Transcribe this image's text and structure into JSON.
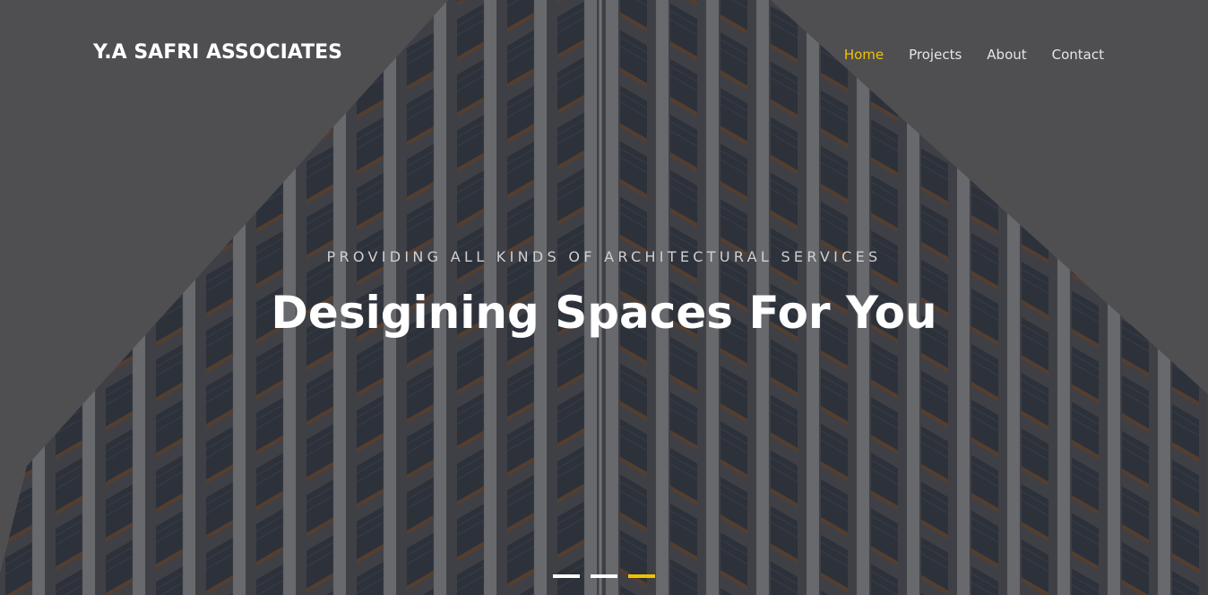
{
  "brand": {
    "name": "Y.A SAFRI ASSOCIATES"
  },
  "nav": {
    "items": [
      {
        "label": "Home",
        "active": true
      },
      {
        "label": "Projects",
        "active": false
      },
      {
        "label": "About",
        "active": false
      },
      {
        "label": "Contact",
        "active": false
      }
    ]
  },
  "hero": {
    "tagline": "PROVIDING ALL KINDS OF ARCHITECTURAL SERVICES",
    "headline": "Desigining Spaces For You",
    "slides_total": 3,
    "active_slide": 3
  },
  "colors": {
    "accent": "#f2c200",
    "text": "#ffffff",
    "overlay": "#5f6063"
  }
}
